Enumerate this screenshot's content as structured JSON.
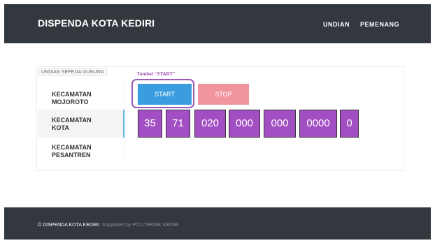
{
  "navbar": {
    "brand": "DISPENDA KOTA KEDIRI",
    "links": [
      "UNDIAN",
      "PEMENANG"
    ]
  },
  "panel": {
    "title": "UNDIAN SEPEDA GUNUNG",
    "sidebar": [
      {
        "line1": "KECAMATAN",
        "line2": "MOJOROTO",
        "active": false
      },
      {
        "line1": "KECAMATAN",
        "line2": "KOTA",
        "active": true
      },
      {
        "line1": "KECAMATAN",
        "line2": "PESANTREN",
        "active": false
      }
    ],
    "annotation": "Tombol \"START\"",
    "start_label": "START",
    "stop_label": "STOP",
    "digits": [
      "35",
      "71",
      "020",
      "000",
      "000",
      "0000",
      "0"
    ]
  },
  "footer": {
    "owner": "© DISPENDA KOTA KEDIRI.",
    "supported": " Supported by POLITEKNIK KEDIRI"
  },
  "colors": {
    "navbar_bg": "#32383e",
    "start_button": "#3a9ddd",
    "stop_button": "#f0949e",
    "digit_box": "#a24fc3",
    "highlight": "#9b59b6",
    "active_accent": "#5bc0de"
  }
}
